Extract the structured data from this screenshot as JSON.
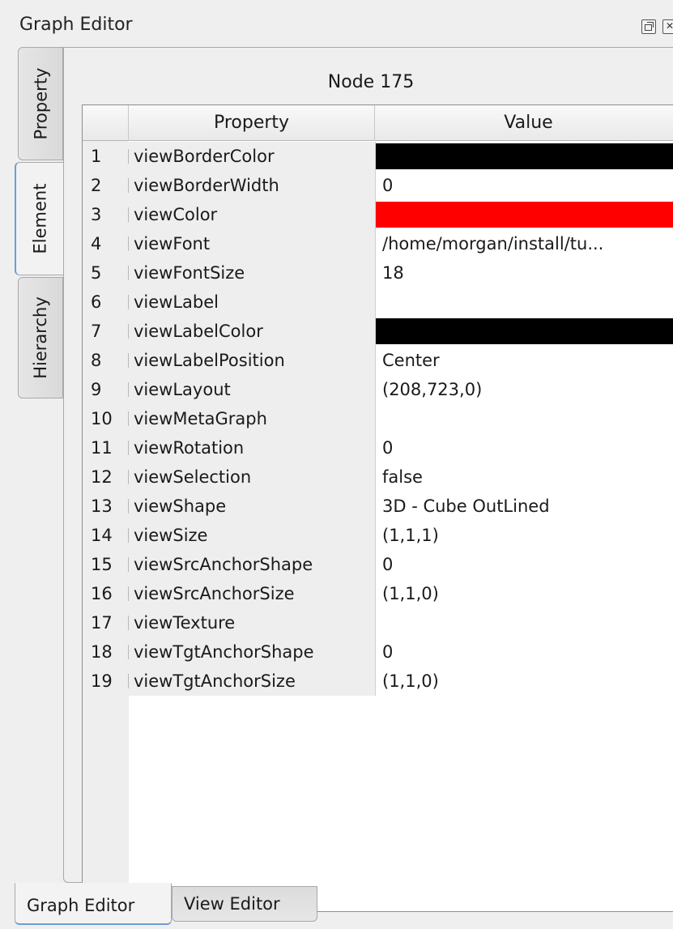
{
  "dock": {
    "title": "Graph Editor"
  },
  "side_tabs": [
    {
      "label": "Property",
      "active": false
    },
    {
      "label": "Element",
      "active": true
    },
    {
      "label": "Hierarchy",
      "active": false
    }
  ],
  "panel": {
    "title": "Node 175",
    "columns": [
      "Property",
      "Value"
    ],
    "rows": [
      {
        "num": "1",
        "property": "viewBorderColor",
        "value": "",
        "color": "#000000"
      },
      {
        "num": "2",
        "property": "viewBorderWidth",
        "value": "0"
      },
      {
        "num": "3",
        "property": "viewColor",
        "value": "",
        "color": "#ff0000"
      },
      {
        "num": "4",
        "property": "viewFont",
        "value": "/home/morgan/install/tu..."
      },
      {
        "num": "5",
        "property": "viewFontSize",
        "value": "18"
      },
      {
        "num": "6",
        "property": "viewLabel",
        "value": ""
      },
      {
        "num": "7",
        "property": "viewLabelColor",
        "value": "",
        "color": "#000000"
      },
      {
        "num": "8",
        "property": "viewLabelPosition",
        "value": "Center"
      },
      {
        "num": "9",
        "property": "viewLayout",
        "value": "(208,723,0)"
      },
      {
        "num": "10",
        "property": "viewMetaGraph",
        "value": ""
      },
      {
        "num": "11",
        "property": "viewRotation",
        "value": "0"
      },
      {
        "num": "12",
        "property": "viewSelection",
        "value": "false"
      },
      {
        "num": "13",
        "property": "viewShape",
        "value": "3D - Cube OutLined"
      },
      {
        "num": "14",
        "property": "viewSize",
        "value": "(1,1,1)"
      },
      {
        "num": "15",
        "property": "viewSrcAnchorShape",
        "value": "0"
      },
      {
        "num": "16",
        "property": "viewSrcAnchorSize",
        "value": "(1,1,0)"
      },
      {
        "num": "17",
        "property": "viewTexture",
        "value": ""
      },
      {
        "num": "18",
        "property": "viewTgtAnchorShape",
        "value": "0"
      },
      {
        "num": "19",
        "property": "viewTgtAnchorSize",
        "value": "(1,1,0)"
      }
    ]
  },
  "bottom_tabs": [
    {
      "label": "Graph Editor",
      "active": true
    },
    {
      "label": "View Editor",
      "active": false
    }
  ]
}
